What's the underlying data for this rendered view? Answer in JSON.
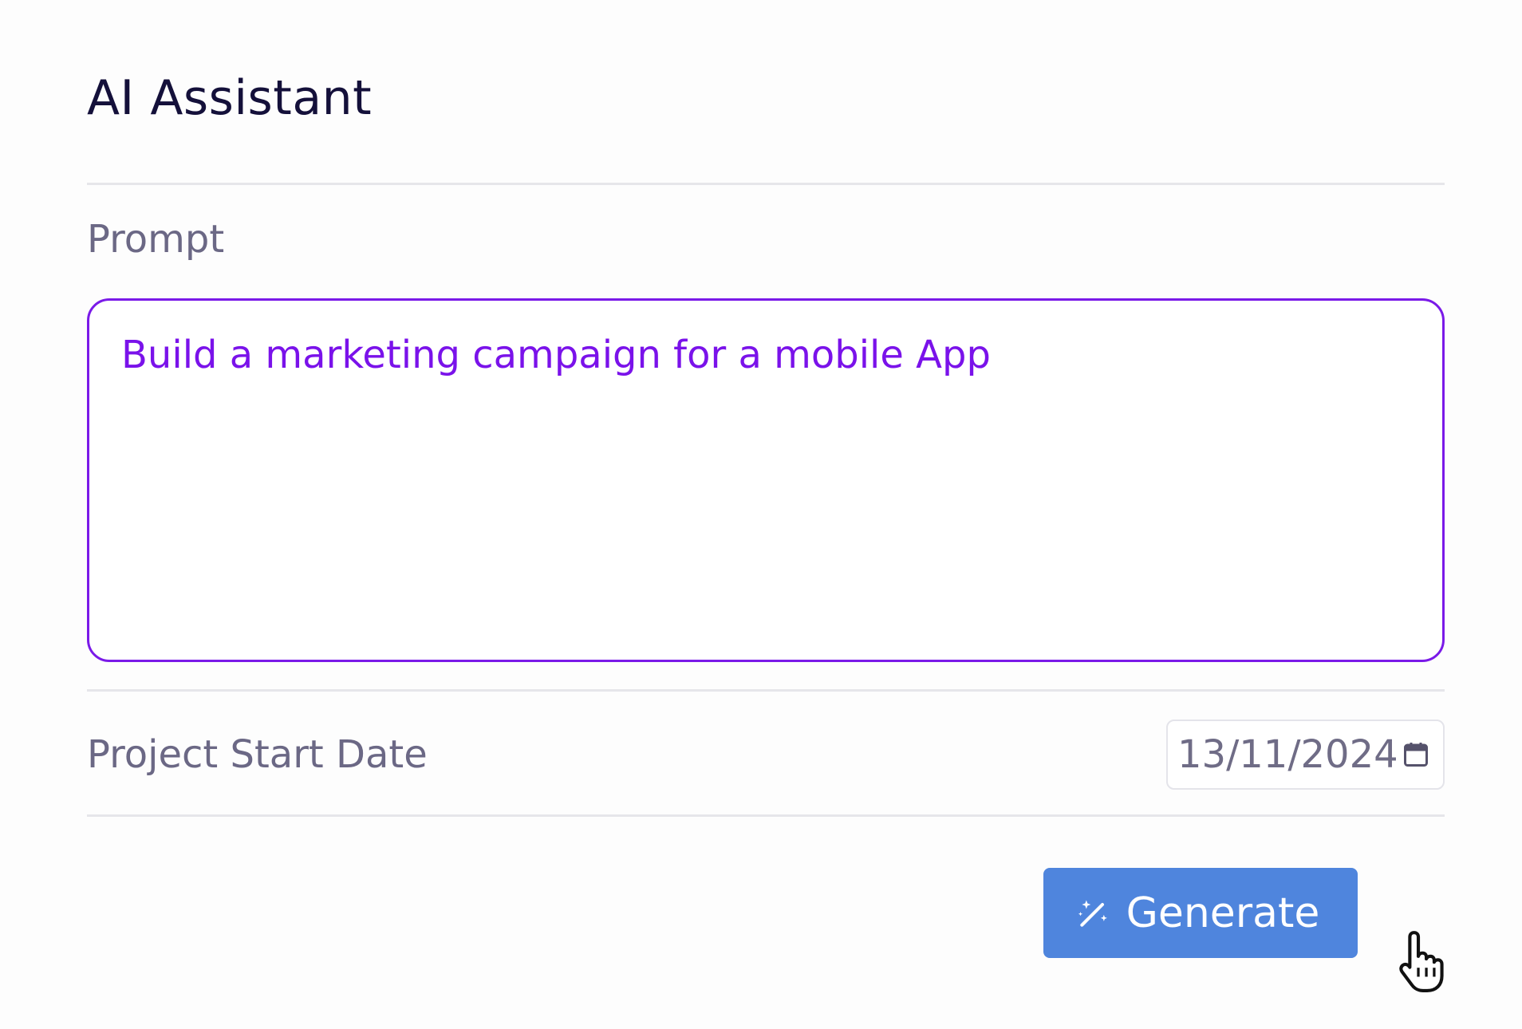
{
  "header": {
    "title": "AI Assistant"
  },
  "prompt": {
    "label": "Prompt",
    "value": "Build a marketing campaign for a mobile App"
  },
  "start_date": {
    "label": "Project Start Date",
    "value": "13/11/2024",
    "icon": "calendar-icon"
  },
  "actions": {
    "generate_label": "Generate",
    "generate_icon": "magic-wand-icon"
  },
  "colors": {
    "title": "#14103a",
    "label": "#6b6885",
    "accent_purple": "#7a12ea",
    "button_blue": "#4f85dd"
  }
}
